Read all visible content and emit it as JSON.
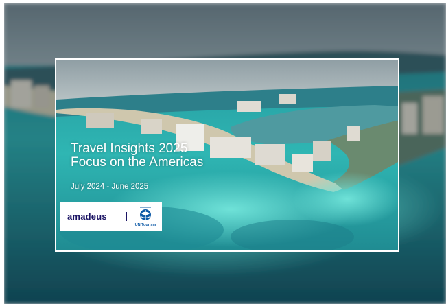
{
  "cover": {
    "title_line1": "Travel Insights 2025",
    "title_line2": "Focus on the Americas",
    "date_range": "July 2024 - June 2025"
  },
  "logos": {
    "amadeus_text": "amadeus",
    "un_tourism_text": "UN Tourism"
  },
  "colors": {
    "amadeus_navy": "#1b1464",
    "un_tourism_blue": "#0c59a6",
    "frame_border": "#ffffff",
    "sea_turquoise": "#2fb3b0",
    "sea_deep": "#0e4a5a"
  }
}
